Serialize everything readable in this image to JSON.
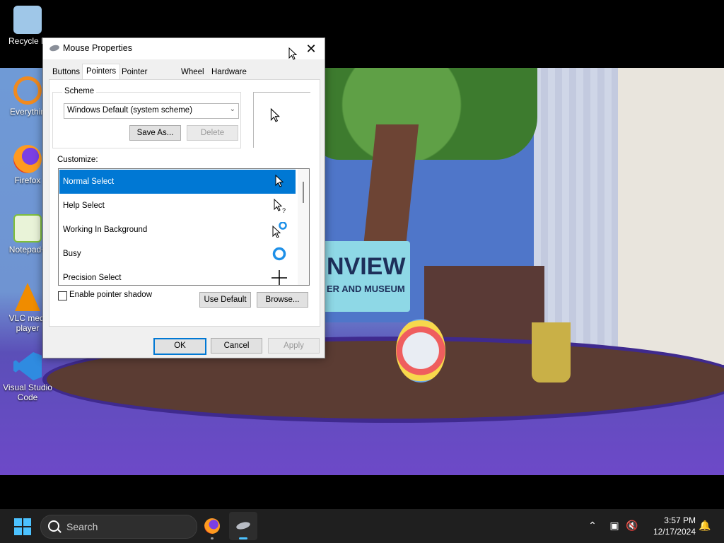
{
  "desktop": {
    "icons": [
      {
        "label": "Recycle B",
        "color": "#9fc7e8"
      },
      {
        "label": "Everythin",
        "color": "#f08a1f"
      },
      {
        "label": "Firefox",
        "color": "#e8551f"
      },
      {
        "label": "Notepad+",
        "color": "#7fbf3a"
      },
      {
        "label": "VLC medi player",
        "color": "#f08c00"
      },
      {
        "label": "Visual Studio Code",
        "color": "#2f8be0"
      }
    ],
    "scene_sign_text": "NVIEW",
    "scene_sign_sub": "ER AND MUSEUM"
  },
  "dialog": {
    "title": "Mouse Properties",
    "close_label": "✕",
    "tabs": [
      "Buttons",
      "Pointers",
      "Pointer Options",
      "Wheel",
      "Hardware"
    ],
    "active_tab": "Pointers",
    "scheme_group_label": "Scheme",
    "scheme_value": "Windows Default (system scheme)",
    "save_as_label": "Save As...",
    "delete_label": "Delete",
    "customize_label": "Customize:",
    "cursors": [
      {
        "name": "Normal Select",
        "icon": "arrow-cursor-icon",
        "selected": true
      },
      {
        "name": "Help Select",
        "icon": "help-cursor-icon",
        "selected": false
      },
      {
        "name": "Working In Background",
        "icon": "working-cursor-icon",
        "selected": false
      },
      {
        "name": "Busy",
        "icon": "busy-cursor-icon",
        "selected": false
      },
      {
        "name": "Precision Select",
        "icon": "crosshair-cursor-icon",
        "selected": false
      }
    ],
    "pointer_shadow_label": "Enable pointer shadow",
    "pointer_shadow_checked": false,
    "use_default_label": "Use Default",
    "browse_label": "Browse...",
    "ok_label": "OK",
    "cancel_label": "Cancel",
    "apply_label": "Apply",
    "accent_color": "#0078d4"
  },
  "taskbar": {
    "search_placeholder": "Search",
    "time": "3:57 PM",
    "date": "12/17/2024"
  }
}
